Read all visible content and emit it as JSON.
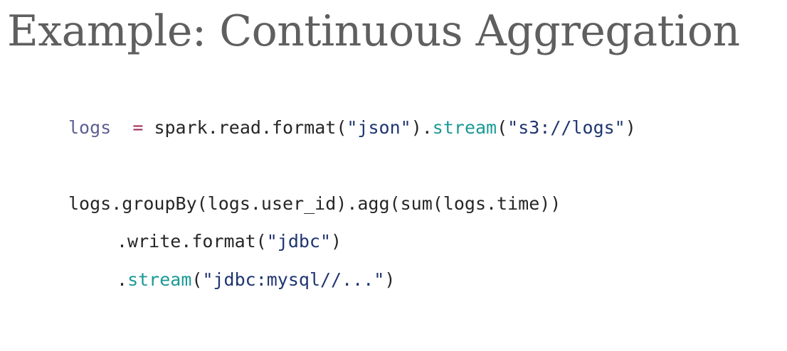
{
  "slide": {
    "title": "Example: Continuous Aggregation"
  },
  "colors": {
    "title": "#5f5f5f",
    "code_text": "#262626",
    "variable": "#5d5f93",
    "operator": "#a0305c",
    "string": "#1f3570",
    "keyword": "#1b9a95"
  },
  "code": {
    "line1": {
      "var": "logs",
      "pad": "  ",
      "op": "=",
      "t1": " spark.read.format(",
      "s1": "\"json\"",
      "t2": ").",
      "kw": "stream",
      "t3": "(",
      "s2": "\"s3://logs\"",
      "t4": ")"
    },
    "line2": {
      "text": "logs.groupBy(logs.user_id).agg(sum(logs.time))"
    },
    "line3": {
      "t1": ".write.format(",
      "s1": "\"jdbc\"",
      "t2": ")"
    },
    "line4": {
      "t1": ".",
      "kw": "stream",
      "t2": "(",
      "s1": "\"jdbc:mysql//...\"",
      "t3": ")"
    }
  }
}
